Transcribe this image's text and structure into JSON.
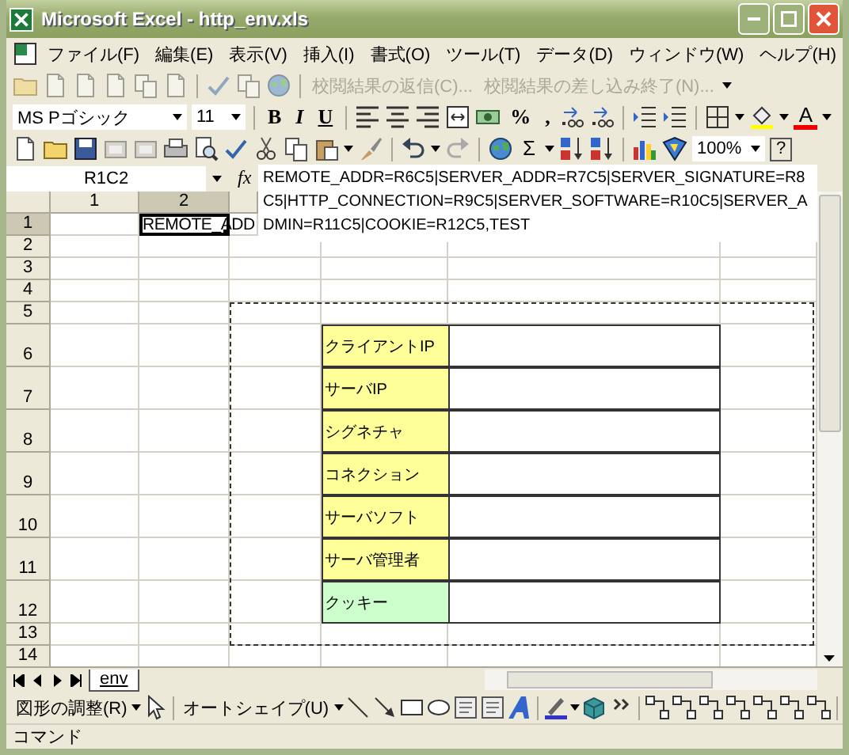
{
  "window": {
    "title": "Microsoft Excel - http_env.xls"
  },
  "menu": [
    "ファイル(F)",
    "編集(E)",
    "表示(V)",
    "挿入(I)",
    "書式(O)",
    "ツール(T)",
    "データ(D)",
    "ウィンドウ(W)",
    "ヘルプ(H)"
  ],
  "review_toolbar": {
    "buttons": [
      {
        "label": "校閲結果の返信(C)...",
        "disabled": true
      },
      {
        "label": "校閲結果の差し込み終了(N)...",
        "disabled": true
      }
    ]
  },
  "format_toolbar": {
    "font": "MS Pゴシック",
    "size": "11",
    "styles": [
      "B",
      "I",
      "U"
    ],
    "percent": "%",
    "comma": ",",
    "font_color": "A"
  },
  "standard_toolbar": {
    "sum": "Σ",
    "zoom": "100%",
    "help": "?"
  },
  "formula_bar": {
    "name_box": "R1C2",
    "fx": "fx",
    "formula": "REMOTE_ADDR=R6C5|SERVER_ADDR=R7C5|SERVER_SIGNATURE=R8C5|HTTP_CONNECTION=R9C5|SERVER_SOFTWARE=R10C5|SERVER_ADMIN=R11C5|COOKIE=R12C5,TEST"
  },
  "sheet": {
    "columns": [
      {
        "label": "1",
        "selected": false
      },
      {
        "label": "2",
        "selected": true
      }
    ],
    "rows": [
      {
        "header": "1",
        "selected": true,
        "active_cell": "REMOTE_ADD"
      },
      {
        "header": "2",
        "selected": false
      },
      {
        "header": "3",
        "selected": false
      },
      {
        "header": "4",
        "selected": false
      },
      {
        "header": "5",
        "selected": false
      },
      {
        "header": "6",
        "selected": false,
        "label": "クライアントIP",
        "color": "#ffff99"
      },
      {
        "header": "7",
        "selected": false,
        "label": "サーバIP",
        "color": "#ffff99"
      },
      {
        "header": "8",
        "selected": false,
        "label": "シグネチャ",
        "color": "#ffff99"
      },
      {
        "header": "9",
        "selected": false,
        "label": "コネクション",
        "color": "#ffff99"
      },
      {
        "header": "10",
        "selected": false,
        "label": "サーバソフト",
        "color": "#ffff99"
      },
      {
        "header": "11",
        "selected": false,
        "label": "サーバ管理者",
        "color": "#ffff99"
      },
      {
        "header": "12",
        "selected": false,
        "label": "クッキー",
        "color": "#ccffcc"
      },
      {
        "header": "13",
        "selected": false
      },
      {
        "header": "14",
        "selected": false
      }
    ]
  },
  "sheet_tabs": [
    {
      "label": "env",
      "selected": true
    }
  ],
  "drawing_toolbar": {
    "draw_menu": "図形の調整(R)",
    "autoshapes": "オートシェイプ(U)"
  },
  "status_bar": "コマンド"
}
